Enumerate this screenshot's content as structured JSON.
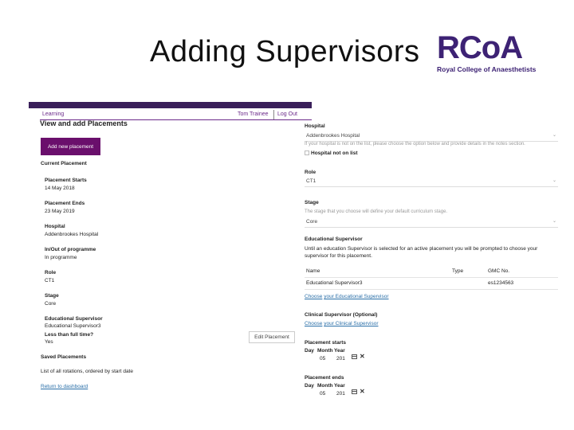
{
  "slide": {
    "title": "Adding Supervisors",
    "logo_mark": "RCoA",
    "logo_sub": "Royal College of Anaesthetists",
    "accent": "#3d2274"
  },
  "left": {
    "nav": {
      "learning": "Learning",
      "user": "Tom Trainee",
      "logout": "Log Out"
    },
    "page_title": "View and add Placements",
    "add_button": "Add new placement",
    "current_title": "Current Placement",
    "fields": [
      {
        "label": "Placement Starts",
        "value": "14 May 2018"
      },
      {
        "label": "Placement Ends",
        "value": "23 May 2019"
      },
      {
        "label": "Hospital",
        "value": "Addenbrookes Hospital"
      },
      {
        "label": "In/Out of programme",
        "value": "In programme"
      },
      {
        "label": "Role",
        "value": "CT1"
      },
      {
        "label": "Stage",
        "value": "Core"
      }
    ],
    "supervisor": {
      "label": "Educational Supervisor",
      "value": "Educational Supervisor3"
    },
    "ltft": {
      "label": "Less than full time?",
      "value": "Yes"
    },
    "edit_button": "Edit Placement",
    "saved_title": "Saved Placements",
    "saved_desc": "List of all rotations, ordered by start date",
    "return_link": "Return to dashboard",
    "brand_color": "#6a0f6c"
  },
  "right": {
    "hospital_label": "Hospital",
    "hospital_value": "Addenbrookes Hospital",
    "hospital_hint": "If your hospital is not on the list, please choose the option below and provide details in the notes section.",
    "hospital_not_listed": "Hospital not on list",
    "role_label": "Role",
    "role_value": "CT1",
    "stage_label": "Stage",
    "stage_hint": "The stage that you choose will define your default curriculum stage.",
    "stage_value": "Core",
    "es_label": "Educational Supervisor",
    "es_desc": "Until an education Supervisor is selected for an active placement you will be prompted to choose your supervisor for this placement.",
    "table_headers": [
      "Name",
      "Type",
      "GMC No."
    ],
    "table_rows": [
      {
        "name": "Educational Supervisor3",
        "type": "",
        "gmc": "es1234563"
      }
    ],
    "choose_es_prefix": "Choose",
    "choose_es_link": "your Educational Supervisor",
    "cs_label": "Clinical Supervisor (Optional)",
    "choose_cs_prefix": "Choose",
    "choose_cs_link": "your Clinical Supervisor",
    "starts_label": "Placement starts",
    "ends_label": "Placement ends",
    "date_headers": [
      "Day",
      "Month",
      "Year"
    ],
    "start_date": {
      "day": "",
      "month": "05",
      "year": "201"
    },
    "end_date": {
      "day": "",
      "month": "05",
      "year": "201"
    }
  }
}
